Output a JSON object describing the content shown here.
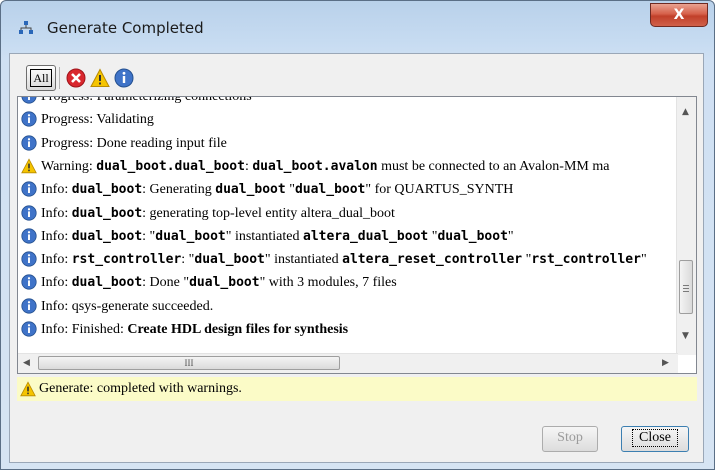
{
  "window": {
    "title": "Generate Completed",
    "close_glyph": "X"
  },
  "filter": {
    "all_label": "All",
    "icons": [
      "error-icon",
      "warning-icon",
      "info-icon"
    ]
  },
  "colors": {
    "info_blue": "#3f73c8",
    "warning_yellow": "#f5c400",
    "error_red": "#d9272e",
    "status_bg": "#fbfbc7"
  },
  "log": [
    {
      "type": "info",
      "parts": [
        {
          "t": "Progress: Parameterizing connections"
        }
      ]
    },
    {
      "type": "info",
      "parts": [
        {
          "t": "Progress: Validating"
        }
      ]
    },
    {
      "type": "info",
      "parts": [
        {
          "t": "Progress: Done reading input file"
        }
      ]
    },
    {
      "type": "warning",
      "parts": [
        {
          "t": "Warning: "
        },
        {
          "t": "dual_boot.dual_boot",
          "b": true
        },
        {
          "t": ": "
        },
        {
          "t": "dual_boot.avalon",
          "b": true
        },
        {
          "t": " must be connected to an Avalon-MM ma"
        }
      ]
    },
    {
      "type": "info",
      "parts": [
        {
          "t": "Info: "
        },
        {
          "t": "dual_boot",
          "b": true
        },
        {
          "t": ": Generating "
        },
        {
          "t": "dual_boot",
          "b": true
        },
        {
          "t": " \""
        },
        {
          "t": "dual_boot",
          "b": true
        },
        {
          "t": "\" for QUARTUS_SYNTH"
        }
      ]
    },
    {
      "type": "info",
      "parts": [
        {
          "t": "Info: "
        },
        {
          "t": "dual_boot",
          "b": true
        },
        {
          "t": ": generating top-level entity altera_dual_boot"
        }
      ]
    },
    {
      "type": "info",
      "parts": [
        {
          "t": "Info: "
        },
        {
          "t": "dual_boot",
          "b": true
        },
        {
          "t": ": \""
        },
        {
          "t": "dual_boot",
          "b": true
        },
        {
          "t": "\" instantiated "
        },
        {
          "t": "altera_dual_boot",
          "b": true
        },
        {
          "t": " \""
        },
        {
          "t": "dual_boot",
          "b": true
        },
        {
          "t": "\""
        }
      ]
    },
    {
      "type": "info",
      "parts": [
        {
          "t": "Info: "
        },
        {
          "t": "rst_controller",
          "b": true
        },
        {
          "t": ": \""
        },
        {
          "t": "dual_boot",
          "b": true
        },
        {
          "t": "\" instantiated "
        },
        {
          "t": "altera_reset_controller",
          "b": true
        },
        {
          "t": " \""
        },
        {
          "t": "rst_controller",
          "b": true
        },
        {
          "t": "\""
        }
      ]
    },
    {
      "type": "info",
      "parts": [
        {
          "t": "Info: "
        },
        {
          "t": "dual_boot",
          "b": true
        },
        {
          "t": ": Done \""
        },
        {
          "t": "dual_boot",
          "b": true
        },
        {
          "t": "\" with 3 modules, 7 files"
        }
      ]
    },
    {
      "type": "info",
      "parts": [
        {
          "t": "Info: qsys-generate succeeded."
        }
      ]
    },
    {
      "type": "info",
      "parts": [
        {
          "t": "Info: Finished: "
        },
        {
          "t": "Create HDL design files for synthesis",
          "b2": true
        }
      ]
    }
  ],
  "scrollbars": {
    "hscroll_grip": "III",
    "left_arrow": "◀",
    "right_arrow": "▶",
    "up_arrow": "▲",
    "down_arrow": "▼"
  },
  "status": {
    "icon": "warning-icon",
    "text": "Generate: completed with warnings."
  },
  "buttons": {
    "stop_label": "Stop",
    "close_label": "Close"
  }
}
